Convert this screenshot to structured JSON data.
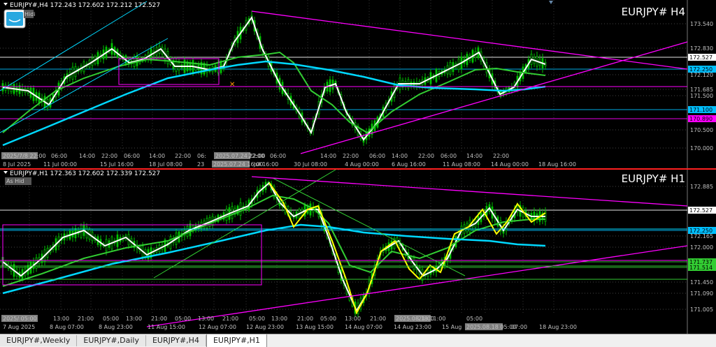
{
  "top_pane": {
    "ohlc": "EURJPY#,H4  172.243 172.602 172.212 172.527",
    "title": "EURJPY#  H4",
    "legend_badge": "Hidi",
    "price_labels": [
      "173.540",
      "172.830",
      "172.527",
      "172.250",
      "172.120",
      "171.685",
      "171.500",
      "171.100",
      "170.890",
      "170.500",
      "170.000"
    ],
    "price_label_colors": [
      "#c0c0c0",
      "#c0c0c0",
      "#ffffff",
      "#00bfff",
      "#c0c0c0",
      "#c0c0c0",
      "#c0c0c0",
      "#00bfff",
      "#ff00ff",
      "#c0c0c0",
      "#c0c0c0"
    ],
    "time_labels": [
      "2025/7/8 22:00",
      "06:00",
      "14:00",
      "22:00",
      "06:00",
      "14:00",
      "22:00",
      "06:",
      "2025.07.24 22:00",
      "22:00",
      "06:00",
      "14:00",
      "22:00",
      "06:00",
      "14:00",
      "22:00",
      "06:00",
      "14:00",
      "22:00"
    ],
    "date_labels": [
      "8 Jul 2025",
      "11 Jul 00:00",
      "15 Jul 16:00",
      "18 Jul 08:00",
      "23",
      "2025.07.24 16:00",
      "Jul 16:00",
      "30 Jul 08:00",
      "4 Aug 00:00",
      "6 Aug 16:00",
      "11 Aug 08:00",
      "14 Aug 00:00",
      "18 Aug 16:00"
    ]
  },
  "bottom_pane": {
    "ohlc": "EURJPY#,H1  172.363 172.602 172.339 172.527",
    "title": "EURJPY#  H1",
    "legend_badge": "As Hid",
    "price_labels": [
      "172.885",
      "172.527",
      "172.250",
      "172.165",
      "172.000",
      "171.737",
      "171.514",
      "171.450",
      "171.090",
      "171.005"
    ],
    "price_label_colors": [
      "#c0c0c0",
      "#ffffff",
      "#00bfff",
      "#c0c0c0",
      "#c0c0c0",
      "#32cd32",
      "#32cd32",
      "#c0c0c0",
      "#c0c0c0",
      "#c0c0c0"
    ],
    "time_labels": [
      "2025/ 05:00",
      "13:00",
      "21:00",
      "05:00",
      "13:00",
      "21:00",
      "05:00",
      "13:00",
      "21:00",
      "05:00",
      "13:00",
      "21:00",
      "05:00",
      "13:00",
      "21:00",
      "2025.08.18 11:00",
      "21:00",
      "05:00"
    ],
    "date_labels": [
      "7 Aug 2025",
      "8 Aug 07:00",
      "8 Aug 23:00",
      "11 Aug 15:00",
      "12 Aug 07:00",
      "12 Aug 23:00",
      "13 Aug 15:00",
      "14 Aug 07:00",
      "14 Aug 23:00",
      "15 Aug",
      "2025.08.18 05:00",
      "07:00",
      "18 Aug 23:00"
    ]
  },
  "tabs": [
    {
      "label": "EURJPY#,Weekly",
      "active": false
    },
    {
      "label": "EURJPY#,Daily",
      "active": false
    },
    {
      "label": "EURJPY#,H4",
      "active": false
    },
    {
      "label": "EURJPY#,H1",
      "active": true
    }
  ],
  "colors": {
    "background": "#000000",
    "candles": "#00c000",
    "wma_fast": "#ffffff",
    "wma_mid": "#32cd32",
    "wma_slow": "#00d8ff",
    "trendline": "#ff00ff",
    "yellow_zigzag": "#ffff00"
  }
}
